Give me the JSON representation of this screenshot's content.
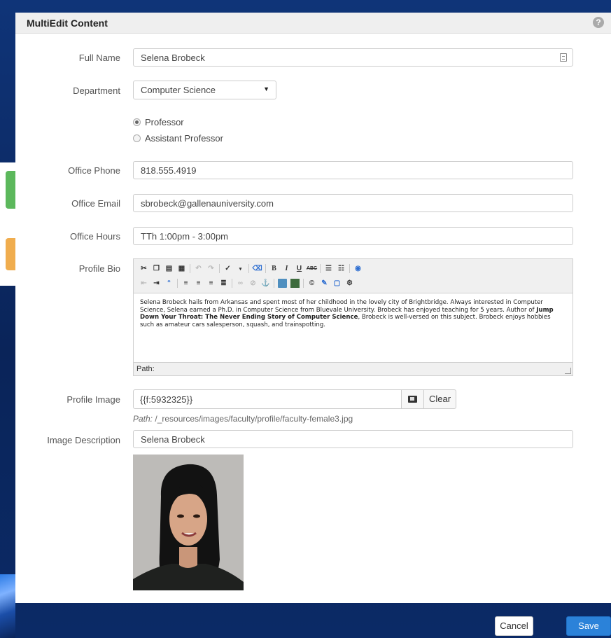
{
  "modal": {
    "title": "MultiEdit Content",
    "help_icon": "question-circle-icon"
  },
  "form": {
    "full_name": {
      "label": "Full Name",
      "value": "Selena Brobeck"
    },
    "department": {
      "label": "Department",
      "value": "Computer Science"
    },
    "rank": {
      "options": [
        {
          "label": "Professor",
          "selected": true
        },
        {
          "label": "Assistant Professor",
          "selected": false
        }
      ]
    },
    "office_phone": {
      "label": "Office Phone",
      "value": "818.555.4919"
    },
    "office_email": {
      "label": "Office Email",
      "value": "sbrobeck@gallenauniversity.com"
    },
    "office_hours": {
      "label": "Office Hours",
      "value": "TTh 1:00pm - 3:00pm"
    },
    "profile_bio": {
      "label": "Profile Bio",
      "text_before": "Selena Brobeck hails from Arkansas and spent most of her childhood in the lovely city of Brightbridge. Always interested in Computer Science, Selena earned a Ph.D. in Computer Science from Bluevale University. Brobeck has enjoyed teaching for 5 years. Author of ",
      "text_bold": "Jump Down Your Throat: The Never Ending Story of Computer Science",
      "text_after": ", Brobeck is well-versed on this subject. Brobeck enjoys hobbies such as amateur cars salesperson, squash, and trainspotting.",
      "path_label": "Path:"
    },
    "profile_image": {
      "label": "Profile Image",
      "value": "{{f:5932325}}",
      "clear_label": "Clear",
      "path_prefix": "Path:",
      "path_value": " /_resources/images/faculty/profile/faculty-female3.jpg"
    },
    "image_description": {
      "label": "Image Description",
      "value": "Selena Brobeck"
    }
  },
  "footer": {
    "cancel_label": "Cancel",
    "save_label": "Save"
  },
  "colors": {
    "primary": "#2b82d9",
    "background": "#0d2f6a",
    "success": "#5cb85c",
    "warning": "#f0ad4e"
  }
}
